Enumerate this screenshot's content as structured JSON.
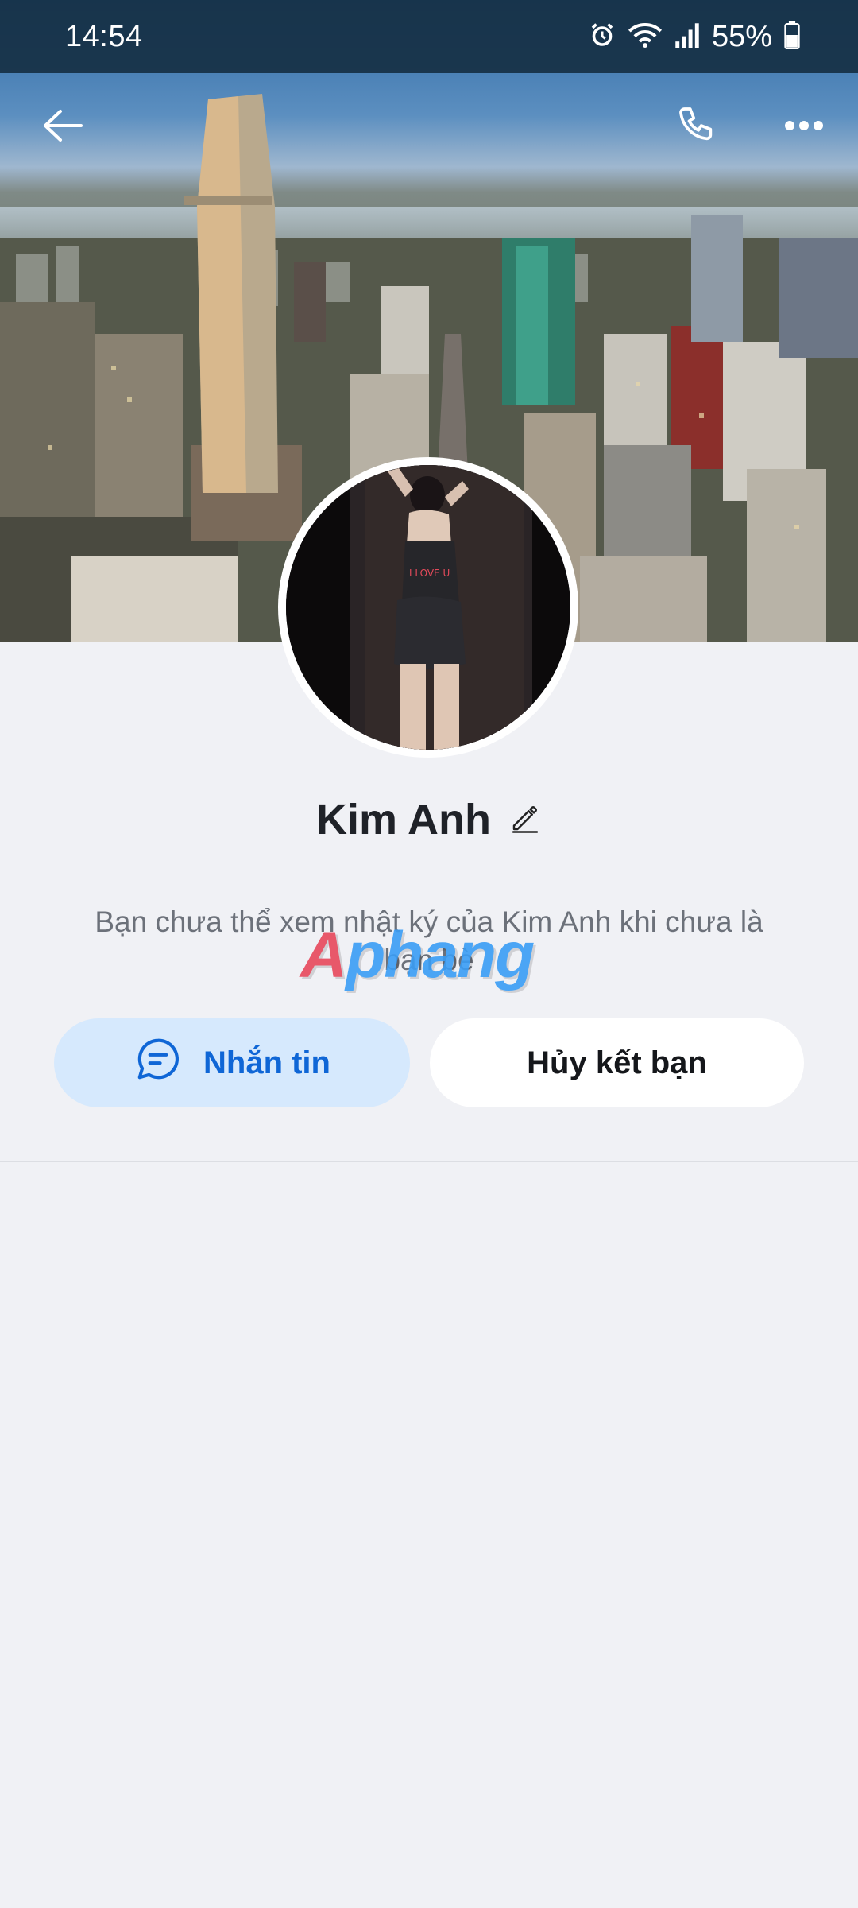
{
  "status_bar": {
    "time": "14:54",
    "battery_percent": "55%",
    "icons": [
      "alarm-icon",
      "wifi-icon",
      "signal-icon",
      "battery-icon"
    ]
  },
  "top_actions": {
    "icons": [
      "back-arrow-icon",
      "phone-icon",
      "more-icon"
    ]
  },
  "profile": {
    "name": "Kim Anh",
    "notice": "Bạn chưa thể xem nhật ký của Kim Anh khi chưa là bạn bè",
    "avatar_text": "I LOVE U"
  },
  "actions": {
    "message_label": "Nhắn tin",
    "unfriend_label": "Hủy kết bạn"
  },
  "watermark": {
    "first": "A",
    "rest": "phang"
  },
  "colors": {
    "accent": "#0f66d6",
    "message_bg": "#d6e9fd",
    "page_bg": "#f0f1f5"
  }
}
